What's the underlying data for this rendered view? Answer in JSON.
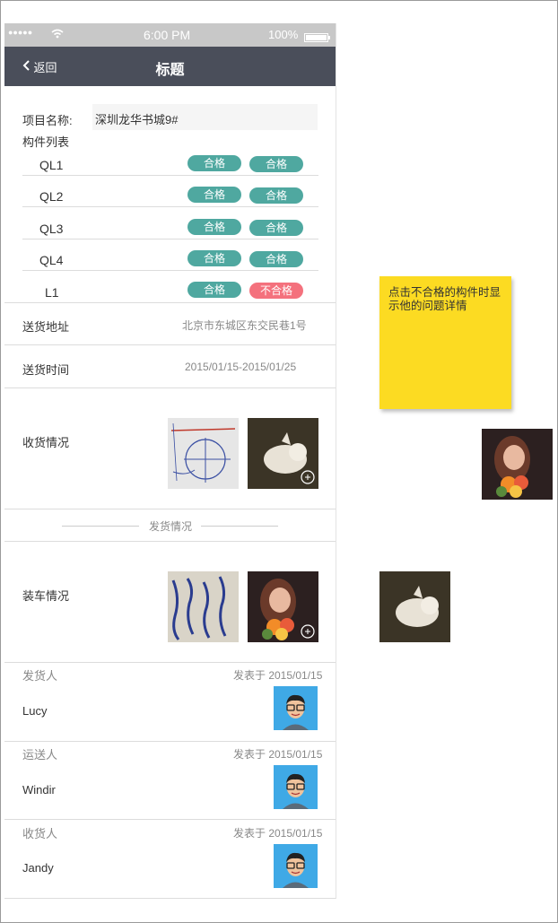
{
  "status_bar": {
    "signal": "●●●●●",
    "time": "6:00 PM",
    "battery": "100%"
  },
  "nav": {
    "back_label": "返回",
    "title": "标题"
  },
  "project": {
    "label": "项目名称:",
    "value": "深圳龙华书城9#"
  },
  "component_list": {
    "label": "构件列表",
    "rows": [
      {
        "name": "QL1",
        "status1": "合格",
        "status2": "合格"
      },
      {
        "name": "QL2",
        "status1": "合格",
        "status2": "合格"
      },
      {
        "name": "QL3",
        "status1": "合格",
        "status2": "合格"
      },
      {
        "name": "QL4",
        "status1": "合格",
        "status2": "合格"
      },
      {
        "name": "L1",
        "status1": "合格",
        "status2": "不合格"
      }
    ]
  },
  "delivery": {
    "address_label": "送货地址",
    "address_value": "北京市东城区东交民巷1号",
    "time_label": "送货时间",
    "time_value": "2015/01/15-2015/01/25"
  },
  "receipt": {
    "label": "收货情况"
  },
  "shipping_divider": "发货情况",
  "loading": {
    "label": "装车情况"
  },
  "people": [
    {
      "role": "发货人",
      "date": "发表于 2015/01/15",
      "name": "Lucy"
    },
    {
      "role": "运送人",
      "date": "发表于 2015/01/15",
      "name": "Windir"
    },
    {
      "role": "收货人",
      "date": "发表于 2015/01/15",
      "name": "Jandy"
    }
  ],
  "sticky_note": {
    "text": "点击不合格的构件时显示他的问题详情"
  },
  "colors": {
    "navbar": "#4a4e5a",
    "pass": "#4fa8a0",
    "fail": "#f4717d",
    "note": "#fcdb22",
    "avatar_bg": "#3fa9e6"
  }
}
